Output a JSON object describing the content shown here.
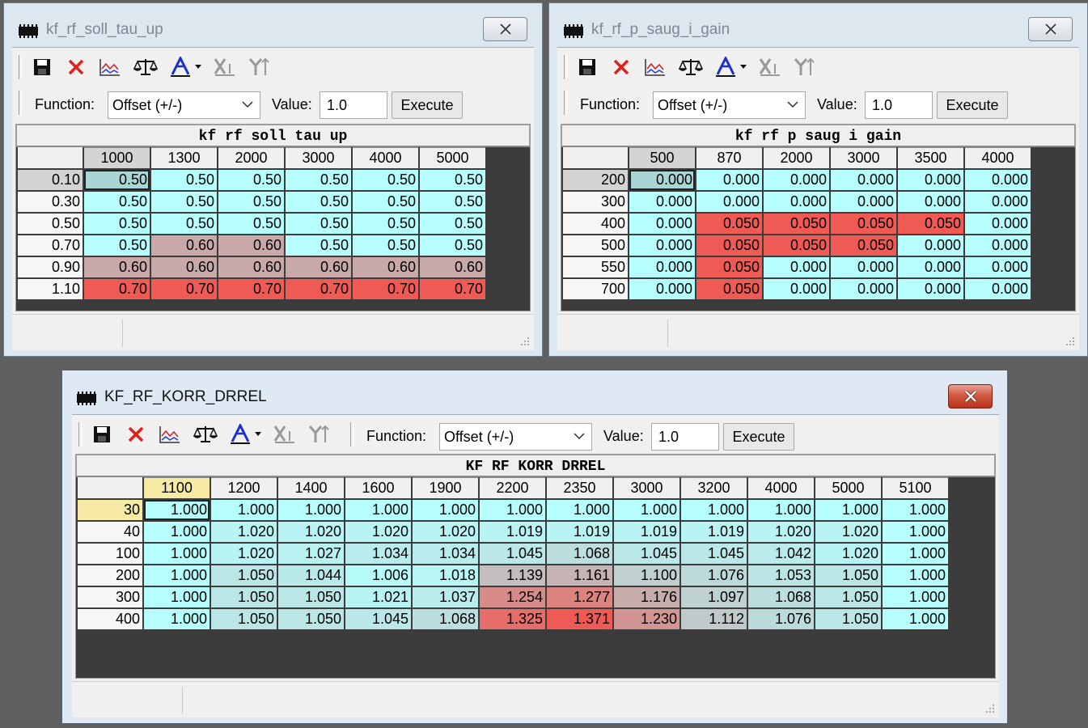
{
  "toolbar": {
    "function_label": "Function:",
    "value_label": "Value:",
    "execute_label": "Execute"
  },
  "windows": [
    {
      "id": "w1",
      "title": "kf_rf_soll_tau_up",
      "map_title": "kf  rf  soll  tau  up",
      "function": "Offset (+/-)",
      "value": "1.0",
      "columns": [
        "1000",
        "1300",
        "2000",
        "3000",
        "4000",
        "5000"
      ],
      "rows": [
        {
          "label": "0.10",
          "values": [
            "0.50",
            "0.50",
            "0.50",
            "0.50",
            "0.50",
            "0.50"
          ]
        },
        {
          "label": "0.30",
          "values": [
            "0.50",
            "0.50",
            "0.50",
            "0.50",
            "0.50",
            "0.50"
          ]
        },
        {
          "label": "0.50",
          "values": [
            "0.50",
            "0.50",
            "0.50",
            "0.50",
            "0.50",
            "0.50"
          ]
        },
        {
          "label": "0.70",
          "values": [
            "0.50",
            "0.60",
            "0.60",
            "0.50",
            "0.50",
            "0.50"
          ]
        },
        {
          "label": "0.90",
          "values": [
            "0.60",
            "0.60",
            "0.60",
            "0.60",
            "0.60",
            "0.60"
          ]
        },
        {
          "label": "1.10",
          "values": [
            "0.70",
            "0.70",
            "0.70",
            "0.70",
            "0.70",
            "0.70"
          ]
        }
      ]
    },
    {
      "id": "w2",
      "title": "kf_rf_p_saug_i_gain",
      "map_title": "kf  rf  p  saug  i  gain",
      "function": "Offset (+/-)",
      "value": "1.0",
      "columns": [
        "500",
        "870",
        "2000",
        "3000",
        "3500",
        "4000"
      ],
      "rows": [
        {
          "label": "200",
          "values": [
            "0.000",
            "0.000",
            "0.000",
            "0.000",
            "0.000",
            "0.000"
          ]
        },
        {
          "label": "300",
          "values": [
            "0.000",
            "0.000",
            "0.000",
            "0.000",
            "0.000",
            "0.000"
          ]
        },
        {
          "label": "400",
          "values": [
            "0.000",
            "0.050",
            "0.050",
            "0.050",
            "0.050",
            "0.000"
          ]
        },
        {
          "label": "500",
          "values": [
            "0.000",
            "0.050",
            "0.050",
            "0.050",
            "0.000",
            "0.000"
          ]
        },
        {
          "label": "550",
          "values": [
            "0.000",
            "0.050",
            "0.000",
            "0.000",
            "0.000",
            "0.000"
          ]
        },
        {
          "label": "700",
          "values": [
            "0.000",
            "0.050",
            "0.000",
            "0.000",
            "0.000",
            "0.000"
          ]
        }
      ]
    },
    {
      "id": "w3",
      "title": "KF_RF_KORR_DRREL",
      "map_title": "KF  RF  KORR  DRREL",
      "function": "Offset (+/-)",
      "value": "1.0",
      "columns": [
        "1100",
        "1200",
        "1400",
        "1600",
        "1900",
        "2200",
        "2350",
        "3000",
        "3200",
        "4000",
        "5000",
        "5100"
      ],
      "rows": [
        {
          "label": "30",
          "values": [
            "1.000",
            "1.000",
            "1.000",
            "1.000",
            "1.000",
            "1.000",
            "1.000",
            "1.000",
            "1.000",
            "1.000",
            "1.000",
            "1.000"
          ]
        },
        {
          "label": "40",
          "values": [
            "1.000",
            "1.020",
            "1.020",
            "1.020",
            "1.020",
            "1.019",
            "1.019",
            "1.019",
            "1.019",
            "1.020",
            "1.020",
            "1.000"
          ]
        },
        {
          "label": "100",
          "values": [
            "1.000",
            "1.020",
            "1.027",
            "1.034",
            "1.034",
            "1.045",
            "1.068",
            "1.045",
            "1.045",
            "1.042",
            "1.020",
            "1.000"
          ]
        },
        {
          "label": "200",
          "values": [
            "1.000",
            "1.050",
            "1.044",
            "1.006",
            "1.018",
            "1.139",
            "1.161",
            "1.100",
            "1.076",
            "1.053",
            "1.050",
            "1.000"
          ]
        },
        {
          "label": "300",
          "values": [
            "1.000",
            "1.050",
            "1.050",
            "1.021",
            "1.037",
            "1.254",
            "1.277",
            "1.176",
            "1.097",
            "1.068",
            "1.050",
            "1.000"
          ]
        },
        {
          "label": "400",
          "values": [
            "1.000",
            "1.050",
            "1.050",
            "1.045",
            "1.068",
            "1.325",
            "1.371",
            "1.230",
            "1.112",
            "1.076",
            "1.050",
            "1.000"
          ]
        }
      ]
    }
  ],
  "colors": {
    "low": "#b6fdfd",
    "high": "#f05a55",
    "mid_gray": "#c8a8a8"
  }
}
